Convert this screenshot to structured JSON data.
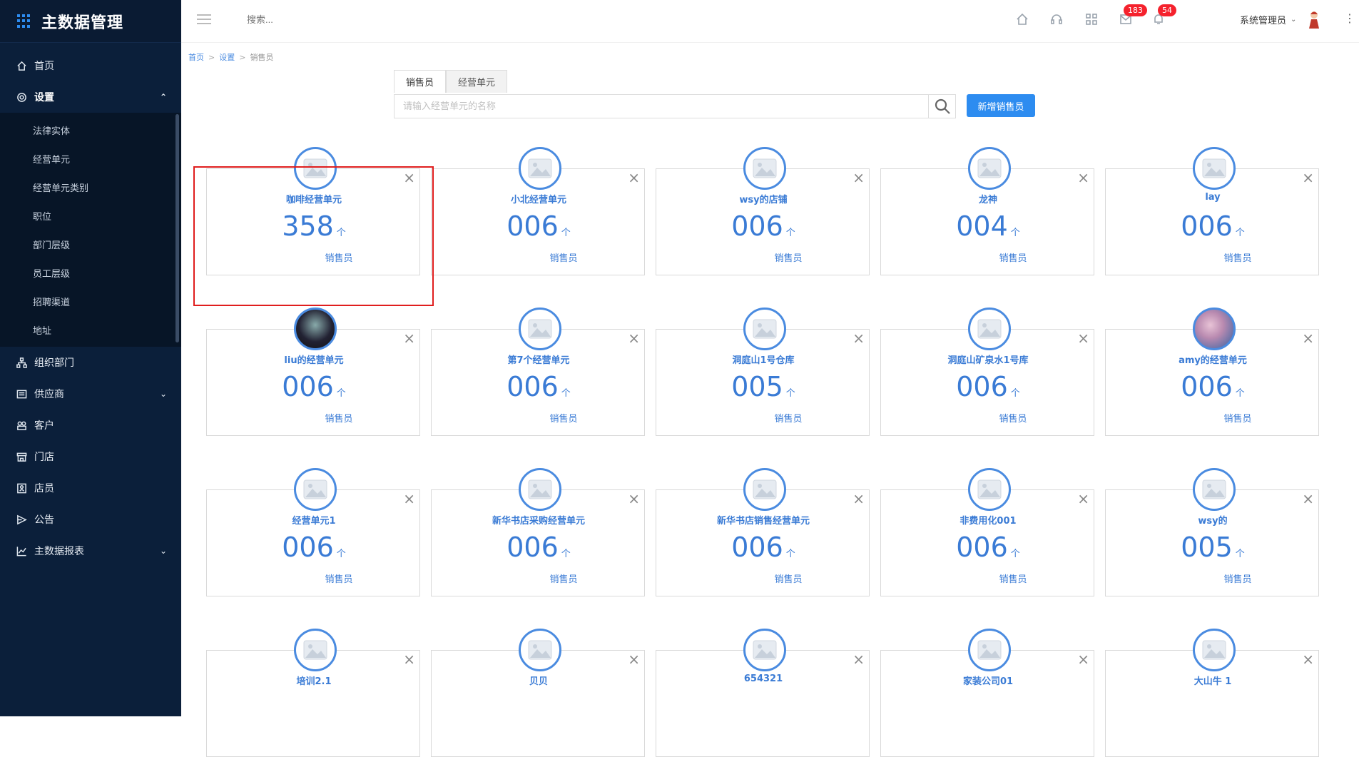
{
  "app": {
    "title": "主数据管理"
  },
  "sidebar": {
    "items": [
      {
        "label": "首页",
        "icon": "home-icon"
      },
      {
        "label": "设置",
        "icon": "gear-icon",
        "expanded": true,
        "children": [
          "法律实体",
          "经营单元",
          "经营单元类别",
          "职位",
          "部门层级",
          "员工层级",
          "招聘渠道",
          "地址"
        ]
      },
      {
        "label": "组织部门",
        "icon": "org-icon"
      },
      {
        "label": "供应商",
        "icon": "supplier-icon",
        "has_children": true
      },
      {
        "label": "客户",
        "icon": "customer-icon"
      },
      {
        "label": "门店",
        "icon": "store-icon"
      },
      {
        "label": "店员",
        "icon": "staff-icon"
      },
      {
        "label": "公告",
        "icon": "notice-icon"
      },
      {
        "label": "主数据报表",
        "icon": "report-icon",
        "has_children": true
      }
    ]
  },
  "topbar": {
    "search_placeholder": "搜索...",
    "badge_messages": "183",
    "badge_notifications": "54",
    "user_name": "系统管理员"
  },
  "breadcrumb": {
    "home": "首页",
    "settings": "设置",
    "current": "销售员",
    "sep": ">"
  },
  "tabs": {
    "tab1": "销售员",
    "tab2": "经营单元"
  },
  "search": {
    "placeholder": "请输入经营单元的名称",
    "add_button": "新增销售员"
  },
  "card_unit": "个",
  "card_label": "销售员",
  "cards": [
    {
      "name": "咖啡经营单元",
      "count": "358"
    },
    {
      "name": "小北经营单元",
      "count": "006"
    },
    {
      "name": "wsy的店铺",
      "count": "006"
    },
    {
      "name": "龙神",
      "count": "004"
    },
    {
      "name": "lay",
      "count": "006"
    },
    {
      "name": "liu的经营单元",
      "count": "006",
      "avatar": "photo-dark"
    },
    {
      "name": "第7个经营单元",
      "count": "006"
    },
    {
      "name": "洞庭山1号仓库",
      "count": "005"
    },
    {
      "name": "洞庭山矿泉水1号库",
      "count": "006"
    },
    {
      "name": "amy的经营单元",
      "count": "006",
      "avatar": "photo-flower"
    },
    {
      "name": "经营单元1",
      "count": "006"
    },
    {
      "name": "新华书店采购经营单元",
      "count": "006"
    },
    {
      "name": "新华书店销售经营单元",
      "count": "006"
    },
    {
      "name": "非费用化001",
      "count": "006"
    },
    {
      "name": "wsy的",
      "count": "005"
    },
    {
      "name": "培训2.1",
      "count": ""
    },
    {
      "name": "贝贝",
      "count": ""
    },
    {
      "name": "654321",
      "count": ""
    },
    {
      "name": "家装公司01",
      "count": ""
    },
    {
      "name": "大山牛 1",
      "count": ""
    }
  ],
  "colors": {
    "sidebar_bg": "#0b1f3a",
    "accent": "#2d8cf0",
    "card_text": "#3a7bd5",
    "highlight": "#e01e1e",
    "badge": "#f5222d"
  }
}
